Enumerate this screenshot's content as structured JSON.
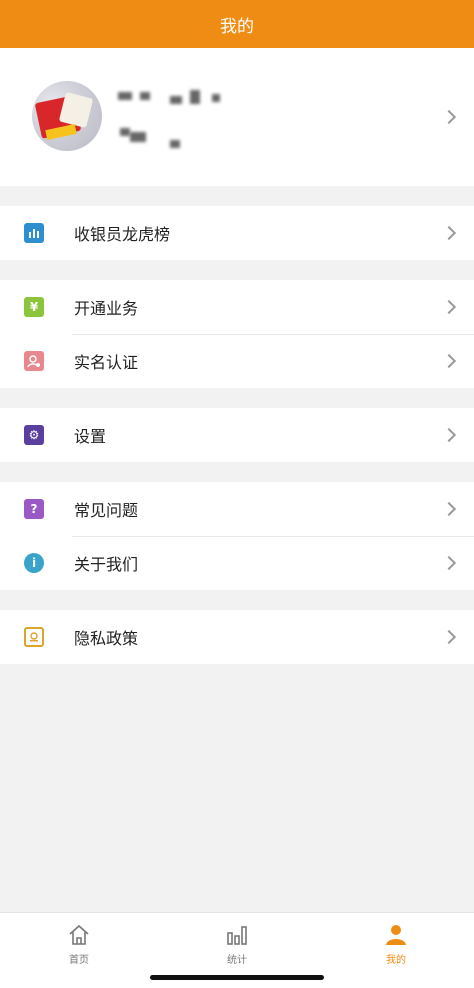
{
  "header": {
    "title": "我的"
  },
  "profile": {
    "avatar": "user-photo"
  },
  "groups": [
    {
      "items": [
        {
          "label": "收银员龙虎榜",
          "icon": "ranking-bar-icon",
          "color": "#2b8fd0"
        }
      ]
    },
    {
      "items": [
        {
          "label": "开通业务",
          "icon": "yuan-icon",
          "color": "#8cc43c"
        },
        {
          "label": "实名认证",
          "icon": "id-verify-icon",
          "color": "#e8888e"
        }
      ]
    },
    {
      "items": [
        {
          "label": "设置",
          "icon": "gear-icon",
          "color": "#5a3fa0"
        }
      ]
    },
    {
      "items": [
        {
          "label": "常见问题",
          "icon": "question-icon",
          "color": "#9b59c6"
        },
        {
          "label": "关于我们",
          "icon": "info-icon",
          "color": "#3aa3c9"
        }
      ]
    },
    {
      "items": [
        {
          "label": "隐私政策",
          "icon": "privacy-doc-icon",
          "color": "#d9a52a"
        }
      ]
    }
  ],
  "tabbar": {
    "tabs": [
      {
        "label": "首页",
        "icon": "home-icon"
      },
      {
        "label": "统计",
        "icon": "stats-icon"
      },
      {
        "label": "我的",
        "icon": "person-icon",
        "active": true
      }
    ],
    "accent": "#ef8c14"
  }
}
